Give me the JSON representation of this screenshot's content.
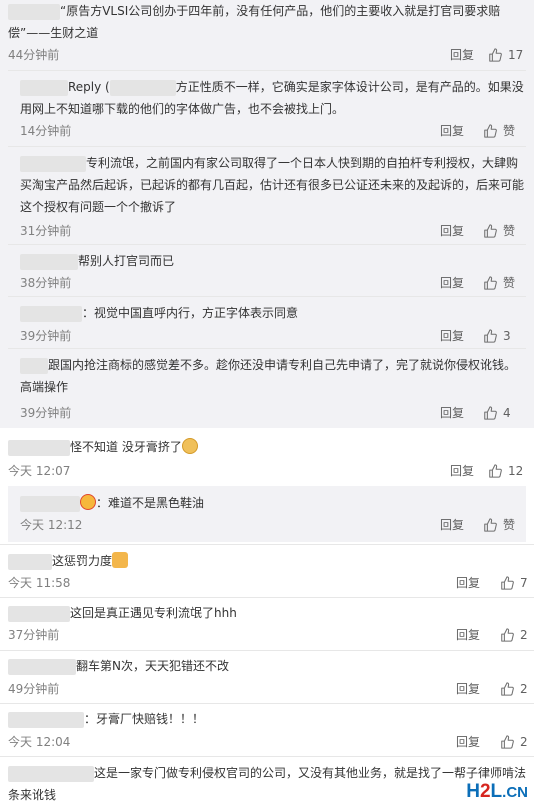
{
  "comments": [
    {
      "id": "c1",
      "text": "“原告方VLSI公司创办于四年前，没有任何产品，他们的主要收入就是打官司要求赔偿”——生财之道",
      "time": "44分钟前",
      "reply": "回复",
      "likes": "17"
    },
    {
      "id": "c2",
      "prefix": "Reply (",
      "text": "方正性质不一样，它确实是家字体设计公司，是有产品的。如果没用网上不知道哪下载的他们的字体做广告，也不会被找上门。",
      "time": "14分钟前",
      "reply": "回复",
      "likes": "赞"
    },
    {
      "id": "c3",
      "text": "专利流氓，之前国内有家公司取得了一个日本人快到期的自拍杆专利授权，大肆购买淘宝产品然后起诉，已起诉的都有几百起，估计还有很多已公证还未来的及起诉的，后来可能这个授权有问题一个个撤诉了",
      "time": "31分钟前",
      "reply": "回复",
      "likes": "赞"
    },
    {
      "id": "c4",
      "text": "帮别人打官司而已",
      "time": "38分钟前",
      "reply": "回复",
      "likes": "赞"
    },
    {
      "id": "c5",
      "text": "：视觉中国直呼内行，方正字体表示同意",
      "time": "39分钟前",
      "reply": "回复",
      "likes": "3"
    },
    {
      "id": "c6",
      "text": "跟国内抢注商标的感觉差不多。趁你还没申请专利自己先申请了，完了就说你侵权讹钱。高端操作",
      "time": "39分钟前",
      "reply": "回复",
      "likes": "4"
    },
    {
      "id": "c7",
      "text": "怪不知道 没牙膏挤了",
      "time": "今天 12:07",
      "reply": "回复",
      "likes": "12"
    },
    {
      "id": "c8",
      "text": "：难道不是黑色鞋油",
      "time": "今天 12:12",
      "reply": "回复",
      "likes": "赞"
    },
    {
      "id": "c9",
      "text": "这惩罚力度",
      "time": "今天 11:58",
      "reply": "回复",
      "likes": "7"
    },
    {
      "id": "c10",
      "text": "这回是真正遇见专利流氓了hhh",
      "time": "37分钟前",
      "reply": "回复",
      "likes": "2"
    },
    {
      "id": "c11",
      "text": "翻车第N次，天天犯错还不改",
      "time": "49分钟前",
      "reply": "回复",
      "likes": "2"
    },
    {
      "id": "c12",
      "text": "：牙膏厂快赔钱！！！",
      "time": "今天 12:04",
      "reply": "回复",
      "likes": "2"
    },
    {
      "id": "c13",
      "text": "这是一家专门做专利侵权官司的公司，又没有其他业务，就是找了一帮子律师啃法条来讹钱",
      "time": "",
      "reply": "",
      "likes": ""
    }
  ],
  "watermark": {
    "h": "H",
    "two": "2",
    "l": "L",
    ".cn": ".CN"
  },
  "icons": {
    "like": "thumb-up-icon",
    "emoji_dog": "doge-emoji-icon",
    "emoji_thumb": "thumbs-up-emoji-icon",
    "emoji_chick": "chick-emoji-icon"
  },
  "colors": {
    "text": "#333333",
    "meta": "#808080",
    "sub_bg": "#f2f2f5",
    "watermark_blue": "#0b6eb8",
    "watermark_red": "#d6251e"
  }
}
